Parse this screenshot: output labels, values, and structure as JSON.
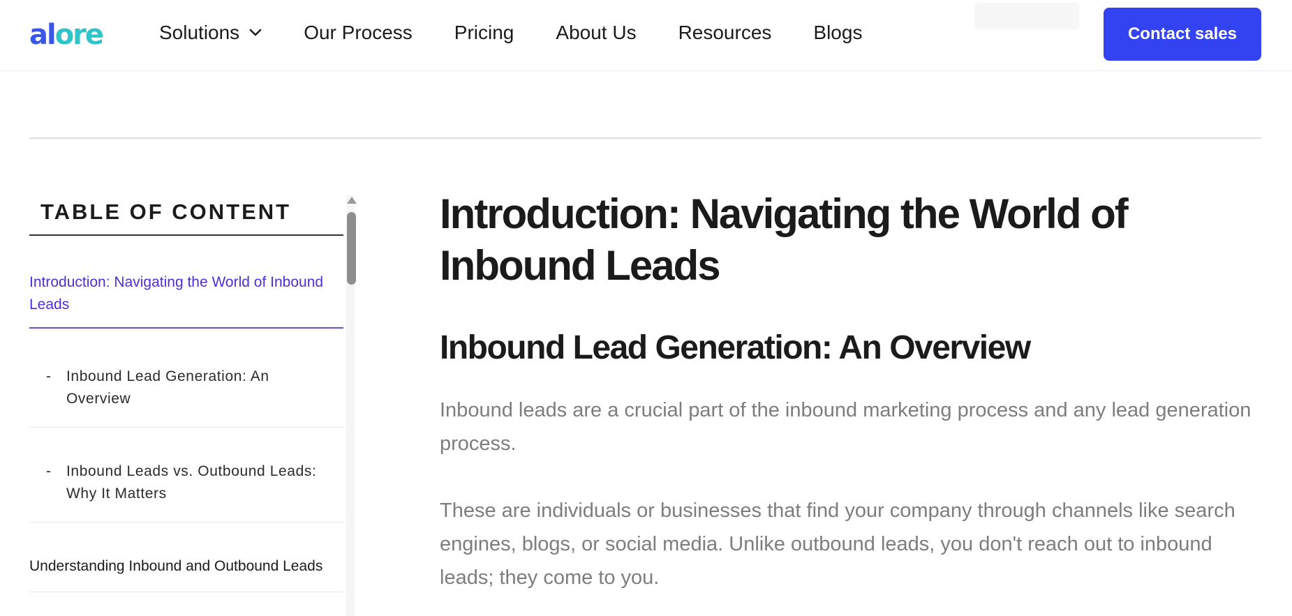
{
  "header": {
    "logo": {
      "part1": "al",
      "part2": "ore"
    },
    "nav": [
      {
        "label": "Solutions",
        "has_dropdown": true
      },
      {
        "label": "Our Process"
      },
      {
        "label": "Pricing"
      },
      {
        "label": "About Us"
      },
      {
        "label": "Resources"
      },
      {
        "label": "Blogs"
      }
    ],
    "cta_label": "Contact sales"
  },
  "toc": {
    "title": "TABLE OF CONTENT",
    "items": [
      {
        "label": "Introduction: Navigating the World of Inbound Leads",
        "active": true,
        "level": 0
      },
      {
        "label": "Inbound Lead Generation: An Overview",
        "level": 1,
        "bullet": "-"
      },
      {
        "label": "Inbound Leads vs. Outbound Leads: Why It Matters",
        "level": 1,
        "bullet": "-"
      },
      {
        "label": "Understanding Inbound and Outbound Leads",
        "level": 0
      }
    ]
  },
  "article": {
    "h1": "Introduction: Navigating the World of Inbound Leads",
    "h2": "Inbound Lead Generation: An Overview",
    "paragraphs": [
      "Inbound leads are a crucial part of the inbound marketing process and any lead generation process.",
      "These are individuals or businesses that find your company through channels like search engines, blogs, or social media. Unlike outbound leads, you don't reach out to inbound leads; they come to you."
    ]
  },
  "colors": {
    "cta_bg": "#3443f2",
    "toc_active": "#4c2fd8",
    "logo_blue": "#3a56e8",
    "logo_teal": "#2fc4c9",
    "body_text": "#7d7d7d"
  }
}
